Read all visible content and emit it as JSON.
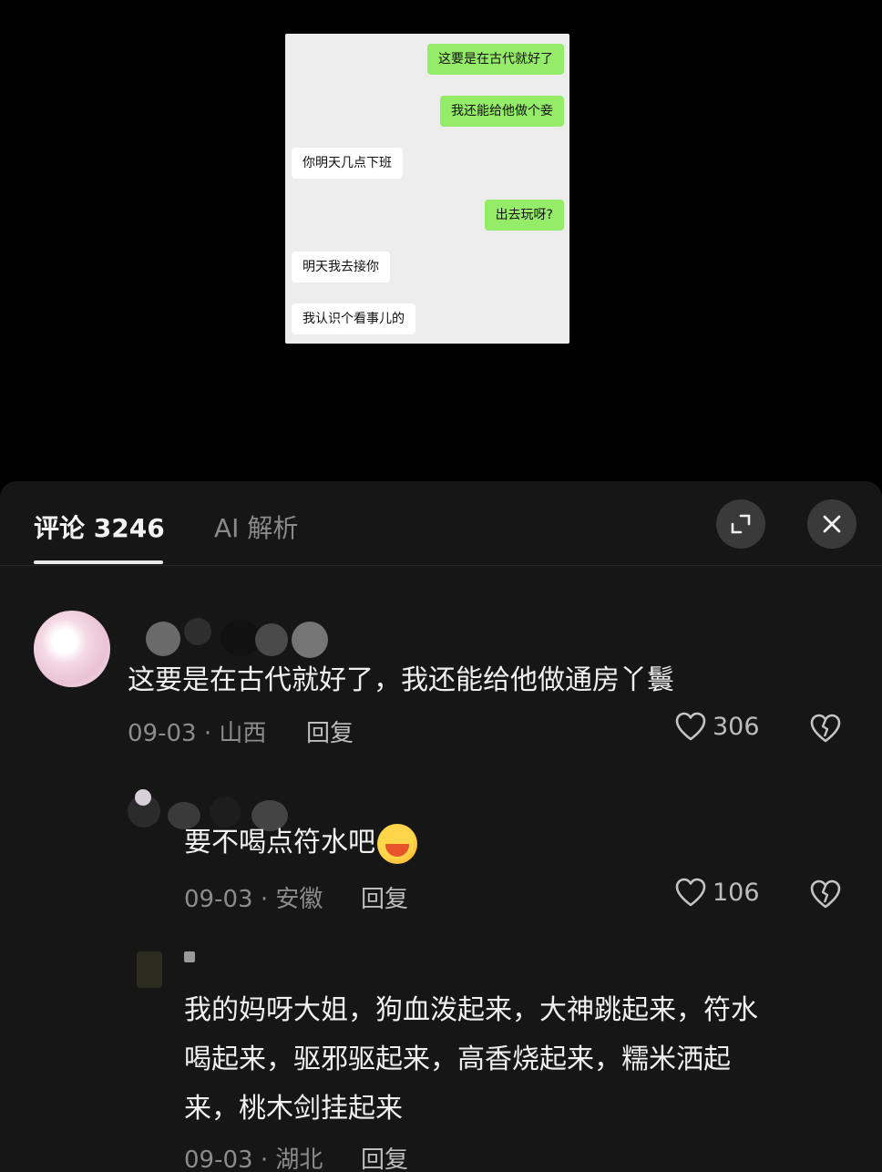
{
  "chat_image": {
    "messages": [
      {
        "side": "me",
        "text": "这要是在古代就好了"
      },
      {
        "side": "me",
        "text": "我还能给他做个妾"
      },
      {
        "side": "them",
        "text": "你明天几点下班"
      },
      {
        "side": "me",
        "text": "出去玩呀?"
      },
      {
        "side": "them",
        "text": "明天我去接你"
      },
      {
        "side": "them",
        "text": "我认识个看事儿的"
      }
    ],
    "colors": {
      "me": "#95ec69",
      "them": "#ffffff",
      "background": "#ededed"
    }
  },
  "panel": {
    "tab_comments": "评论 3246",
    "tab_ai": "AI 解析",
    "expand_icon": "expand-icon",
    "close_icon": "close-icon"
  },
  "comments": [
    {
      "text": "这要是在古代就好了，我还能给他做通房丫鬟",
      "date_location": "09-03 · 山西",
      "reply": "回复",
      "likes": "306"
    },
    {
      "text": "要不喝点符水吧",
      "emoji": "hot-face-emoji",
      "date_location": "09-03 · 安徽",
      "reply": "回复",
      "likes": "106"
    },
    {
      "lines": [
        "我的妈呀大姐，狗血泼起来，大神跳起来，符水",
        "喝起来，驱邪驱起来，高香烧起来，糯米洒起",
        "来，桃木剑挂起来"
      ],
      "date_location": "09-03 · 湖北",
      "reply": "回复"
    }
  ]
}
